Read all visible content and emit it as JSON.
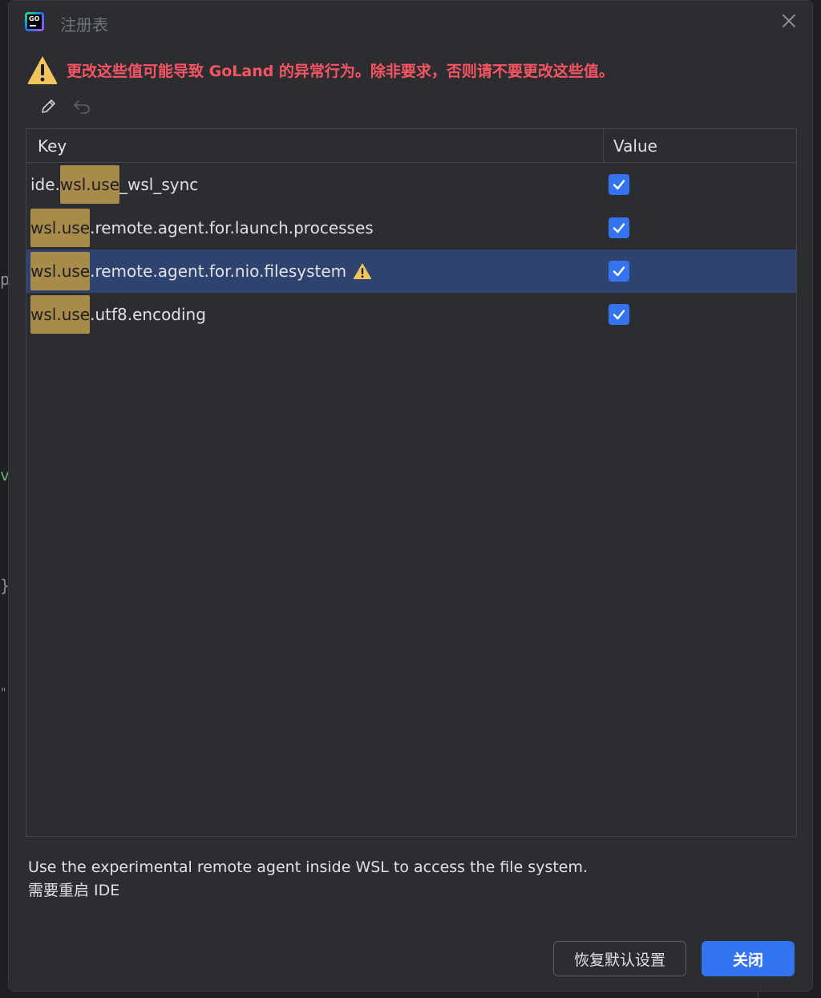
{
  "window": {
    "title": "注册表",
    "app_icon_text": "GO"
  },
  "warning": {
    "message": "更改这些值可能导致 GoLand 的异常行为。除非要求，否则请不要更改这些值。",
    "color": "#f75464"
  },
  "toolbar": {
    "edit_icon": "pencil-icon",
    "revert_icon": "undo-icon"
  },
  "table": {
    "columns": {
      "key": "Key",
      "value": "Value"
    },
    "rows": [
      {
        "prefix": "ide.",
        "highlight": "wsl.use",
        "suffix": "_wsl_sync",
        "checked": true,
        "warning": false,
        "selected": false
      },
      {
        "prefix": "",
        "highlight": "wsl.use",
        "suffix": ".remote.agent.for.launch.processes",
        "checked": true,
        "warning": false,
        "selected": false
      },
      {
        "prefix": "",
        "highlight": "wsl.use",
        "suffix": ".remote.agent.for.nio.filesystem",
        "checked": true,
        "warning": true,
        "selected": true
      },
      {
        "prefix": "",
        "highlight": "wsl.use",
        "suffix": ".utf8.encoding",
        "checked": true,
        "warning": false,
        "selected": false
      }
    ]
  },
  "description": {
    "line1": "Use the experimental remote agent inside WSL to access the file system.",
    "line2": "需要重启 IDE"
  },
  "buttons": {
    "restore_defaults": "恢复默认设置",
    "close": "关闭"
  },
  "colors": {
    "accent": "#3574f0",
    "highlight": "#a88a4a",
    "selected_row": "#2e436e",
    "warning_icon": "#f2c55c"
  }
}
